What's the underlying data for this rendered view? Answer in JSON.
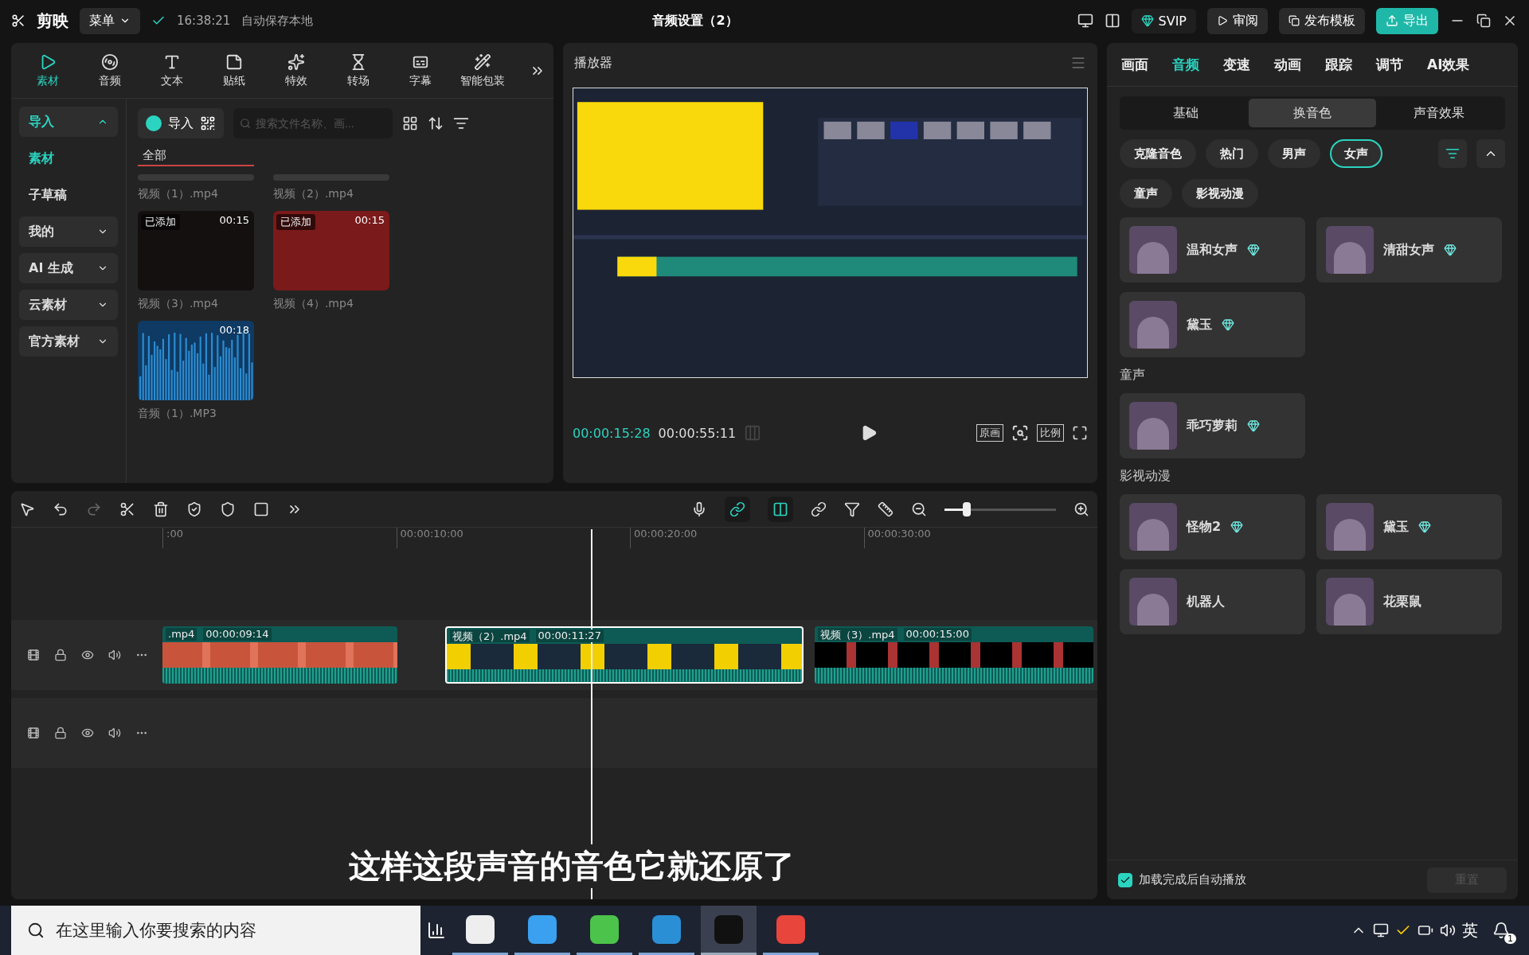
{
  "app": {
    "logo": "剪映",
    "menu": "菜单",
    "save_time": "16:38:21",
    "save_status": "自动保存本地",
    "title": "音频设置（2）",
    "svip": "SVIP",
    "review": "审阅",
    "publish": "发布模板",
    "export": "导出"
  },
  "media_tabs": [
    {
      "label": "素材",
      "selected": true
    },
    {
      "label": "音频",
      "selected": false
    },
    {
      "label": "文本",
      "selected": false
    },
    {
      "label": "贴纸",
      "selected": false
    },
    {
      "label": "特效",
      "selected": false
    },
    {
      "label": "转场",
      "selected": false
    },
    {
      "label": "字幕",
      "selected": false
    },
    {
      "label": "智能包装",
      "selected": false
    }
  ],
  "media_sidebar": [
    {
      "label": "导入",
      "kind": "group",
      "expanded": true,
      "selected": true
    },
    {
      "label": "素材",
      "kind": "item",
      "selected": true
    },
    {
      "label": "子草稿",
      "kind": "item",
      "selected": false
    },
    {
      "label": "我的",
      "kind": "group",
      "expanded": false,
      "selected": false
    },
    {
      "label": "AI 生成",
      "kind": "group",
      "expanded": false,
      "selected": false
    },
    {
      "label": "云素材",
      "kind": "group",
      "expanded": false,
      "selected": false
    },
    {
      "label": "官方素材",
      "kind": "group",
      "expanded": false,
      "selected": false
    }
  ],
  "media": {
    "import": "导入",
    "search_placeholder": "搜索文件名称、画...",
    "filter_tab": "全部",
    "items": [
      {
        "name": "视频（1）.mp4",
        "kind": "partial"
      },
      {
        "name": "视频（2）.mp4",
        "kind": "partial"
      },
      {
        "name": "视频（3）.mp4",
        "kind": "video",
        "badge": "已添加",
        "duration": "00:15"
      },
      {
        "name": "视频（4）.mp4",
        "kind": "video",
        "badge": "已添加",
        "duration": "00:15"
      },
      {
        "name": "音频（1）.MP3",
        "kind": "audio",
        "duration": "00:18"
      }
    ]
  },
  "player": {
    "title": "播放器",
    "current": "00:00:15:28",
    "total": "00:00:55:11",
    "original": "原画",
    "ratio": "比例"
  },
  "timeline": {
    "ticks": [
      ":00",
      "00:00:10:00",
      "00:00:20:00",
      "00:00:30:00"
    ],
    "zoom": {
      "level": 0.2
    },
    "clips": [
      {
        "label": ".mp4",
        "duration": "00:00:09:14",
        "selected": false,
        "kind": "red"
      },
      {
        "label": "视频（2）.mp4",
        "duration": "00:00:11:27",
        "selected": true,
        "kind": "yellow"
      },
      {
        "label": "视频（3）.mp4",
        "duration": "00:00:15:00",
        "selected": false,
        "kind": "dark"
      }
    ]
  },
  "panel": {
    "tabs": [
      {
        "label": "画面",
        "selected": false
      },
      {
        "label": "音频",
        "selected": true
      },
      {
        "label": "变速",
        "selected": false
      },
      {
        "label": "动画",
        "selected": false
      },
      {
        "label": "跟踪",
        "selected": false
      },
      {
        "label": "调节",
        "selected": false
      },
      {
        "label": "AI效果",
        "selected": false
      }
    ],
    "subtabs": [
      {
        "label": "基础",
        "selected": false
      },
      {
        "label": "换音色",
        "selected": true
      },
      {
        "label": "声音效果",
        "selected": false
      }
    ],
    "chips": [
      {
        "label": "克隆音色",
        "selected": false
      },
      {
        "label": "热门",
        "selected": false
      },
      {
        "label": "男声",
        "selected": false
      },
      {
        "label": "女声",
        "selected": true
      },
      {
        "label": "童声",
        "selected": false
      },
      {
        "label": "影视动漫",
        "selected": false
      }
    ],
    "sections": [
      {
        "voices": [
          {
            "name": "温和女声",
            "vip": true
          },
          {
            "name": "清甜女声",
            "vip": true
          },
          {
            "name": "黛玉",
            "vip": true
          }
        ]
      },
      {
        "heading": "童声",
        "voices": [
          {
            "name": "乖巧萝莉",
            "vip": true
          }
        ]
      },
      {
        "heading": "影视动漫",
        "voices": [
          {
            "name": "怪物2",
            "vip": true
          },
          {
            "name": "黛玉",
            "vip": true
          },
          {
            "name": "机器人",
            "vip": false
          },
          {
            "name": "花栗鼠",
            "vip": false
          }
        ]
      }
    ],
    "autoplay": {
      "label": "加载完成后自动播放",
      "checked": true
    },
    "reset": {
      "label": "重置",
      "disabled": true
    }
  },
  "caption": "这样这段声音的音色它就还原了",
  "taskbar": {
    "search_placeholder": "在这里输入你要搜索的内容",
    "apps": [
      {
        "selected": false
      },
      {
        "selected": false
      },
      {
        "selected": false
      },
      {
        "selected": false
      },
      {
        "selected": true
      },
      {
        "selected": false
      }
    ],
    "ime": "英",
    "notifications": "1"
  }
}
